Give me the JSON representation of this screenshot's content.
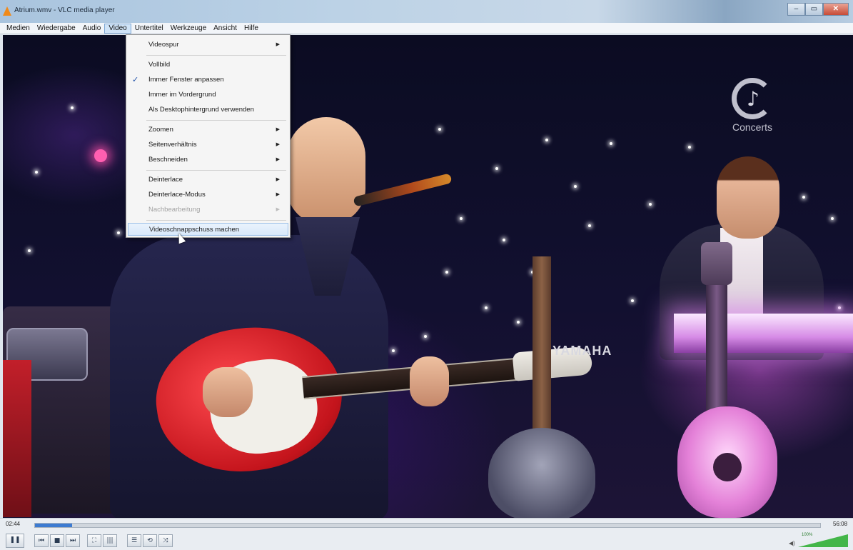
{
  "window": {
    "title": "Atrium.wmv - VLC media player",
    "minimize_glyph": "–",
    "maximize_glyph": "▭",
    "close_glyph": "✕"
  },
  "menubar": {
    "items": [
      {
        "label": "Medien"
      },
      {
        "label": "Wiedergabe"
      },
      {
        "label": "Audio"
      },
      {
        "label": "Video",
        "active": true
      },
      {
        "label": "Untertitel"
      },
      {
        "label": "Werkzeuge"
      },
      {
        "label": "Ansicht"
      },
      {
        "label": "Hilfe"
      }
    ]
  },
  "video_menu": {
    "items": [
      {
        "label": "Videospur",
        "submenu": true
      },
      {
        "label": "Vollbild"
      },
      {
        "label": "Immer Fenster anpassen",
        "checked": true
      },
      {
        "label": "Immer im Vordergrund"
      },
      {
        "label": "Als Desktophintergrund verwenden"
      },
      {
        "label": "Zoomen",
        "submenu": true
      },
      {
        "label": "Seitenverhältnis",
        "submenu": true
      },
      {
        "label": "Beschneiden",
        "submenu": true
      },
      {
        "label": "Deinterlace",
        "submenu": true
      },
      {
        "label": "Deinterlace-Modus",
        "submenu": true
      },
      {
        "label": "Nachbearbeitung",
        "submenu": true,
        "disabled": true
      },
      {
        "label": "Videoschnappschuss machen",
        "highlighted": true
      }
    ],
    "check_glyph": "✓",
    "submenu_glyph": "▶"
  },
  "video": {
    "watermark": {
      "text": "Concerts",
      "icon": "music-note-icon",
      "glyph": "♪"
    },
    "instrument_text": "YAMAHA"
  },
  "playback": {
    "elapsed": "02:44",
    "total": "56:08",
    "progress": 0.047,
    "buttons": {
      "pause": "❚❚",
      "prev": "⏮",
      "stop": "■",
      "next": "⏭",
      "fullscreen": "⛶",
      "ext": "|||",
      "playlist": "☰",
      "loop": "⟲",
      "shuffle": "⤨"
    },
    "volume": {
      "level": 1.0,
      "label": "100%"
    }
  },
  "colors": {
    "accent": "#3d7bd1",
    "menu_highlight": "#d8e8f9",
    "volume": "#43b649"
  }
}
